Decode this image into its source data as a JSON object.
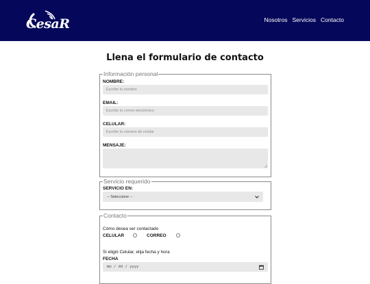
{
  "header": {
    "logo_text": "CesaR",
    "nav": [
      "Nosotros",
      "Servicios",
      "Contacto"
    ],
    "bg_color": "#05085a"
  },
  "page_title": "Llena el formulario de contacto",
  "personal": {
    "legend": "Información personal",
    "nombre_label": "NOMBRE:",
    "nombre_placeholder": "Escribe tu nombre",
    "email_label": "EMAIL:",
    "email_placeholder": "Escribe tu correo electrónico",
    "celular_label": "CELULAR:",
    "celular_placeholder": "Escribe tu número de celular",
    "mensaje_label": "MENSAJE:"
  },
  "servicio": {
    "legend": "Servicio requerido",
    "label": "SERVICIO EN:",
    "selected": "-- Seleccione --"
  },
  "contacto": {
    "legend": "Contacto",
    "question": "Cómo desea ser contactado",
    "option_celular": "CELULAR",
    "option_correo": "CORREO",
    "hint": "Si eligió Celular, elija fecha y hora",
    "fecha_label": "FECHA",
    "fecha_placeholder": "mm / dd / yyyy"
  }
}
